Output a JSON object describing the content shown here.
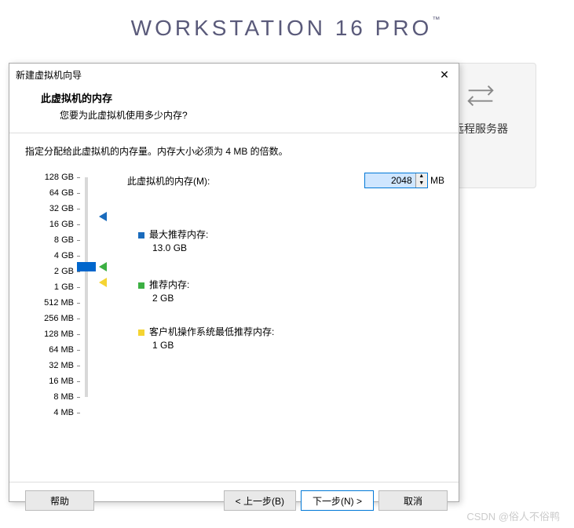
{
  "brand": {
    "text": "WORKSTATION 16 PRO",
    "tm": "™"
  },
  "bgcard": {
    "label": "远程服务器"
  },
  "dialog": {
    "title": "新建虚拟机向导",
    "heading": "此虚拟机的内存",
    "sub": "您要为此虚拟机使用多少内存?",
    "desc": "指定分配给此虚拟机的内存量。内存大小必须为 4 MB 的倍数。",
    "mem_label": "此虚拟机的内存(M):",
    "mem_value": "2048",
    "mem_unit": "MB",
    "scale": [
      "128 GB",
      "64 GB",
      "32 GB",
      "16 GB",
      "8 GB",
      "4 GB",
      "2 GB",
      "1 GB",
      "512 MB",
      "256 MB",
      "128 MB",
      "64 MB",
      "32 MB",
      "16 MB",
      "8 MB",
      "4 MB"
    ],
    "legend": {
      "max": {
        "label": "最大推荐内存:",
        "value": "13.0 GB"
      },
      "rec": {
        "label": "推荐内存:",
        "value": "2 GB"
      },
      "min": {
        "label": "客户机操作系统最低推荐内存:",
        "value": "1 GB"
      }
    },
    "buttons": {
      "help": "帮助",
      "back": "< 上一步(B)",
      "next": "下一步(N) >",
      "cancel": "取消"
    }
  },
  "watermark": "CSDN @俗人不俗鸭"
}
